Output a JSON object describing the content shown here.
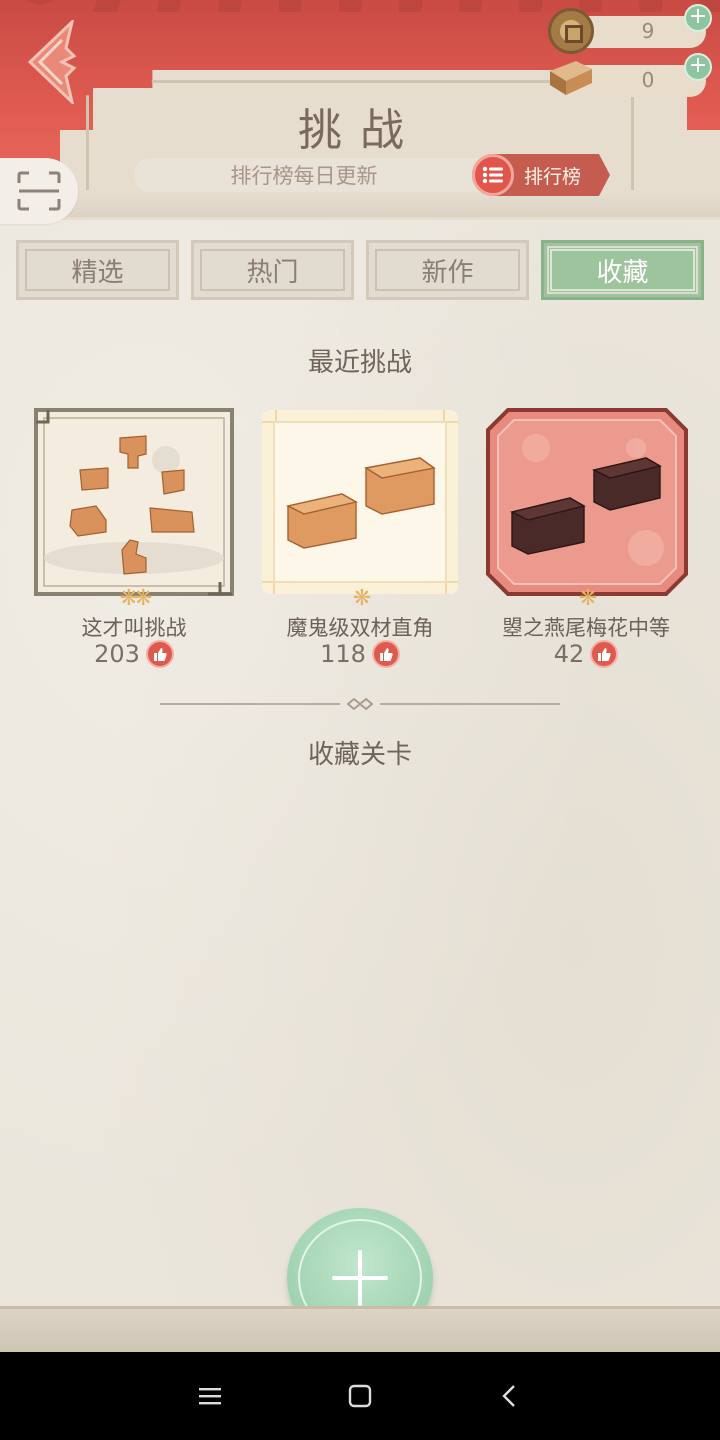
{
  "header": {
    "title": "挑战",
    "subtitle": "排行榜每日更新",
    "rank_button_label": "排行榜",
    "back_icon": "back-arrow-icon",
    "scan_icon": "scan-icon"
  },
  "currency": {
    "coins": "9",
    "wood": "0",
    "plus": "+"
  },
  "tabs": [
    {
      "label": "精选",
      "active": false
    },
    {
      "label": "热门",
      "active": false
    },
    {
      "label": "新作",
      "active": false
    },
    {
      "label": "收藏",
      "active": true
    }
  ],
  "recent": {
    "section_title": "最近挑战",
    "items": [
      {
        "title": "这才叫挑战",
        "likes": "203",
        "difficulty_flowers": "❋❋"
      },
      {
        "title": "魔鬼级双材直角",
        "likes": "118",
        "difficulty_flowers": "❋"
      },
      {
        "title": "曌之燕尾梅花中等",
        "likes": "42",
        "difficulty_flowers": "❋"
      }
    ]
  },
  "favorites": {
    "section_title": "收藏关卡"
  },
  "colors": {
    "header_red": "#e25d52",
    "active_tab": "#9ec49e",
    "like_red": "#de5a4f",
    "fab_green": "#8fcaa3"
  }
}
